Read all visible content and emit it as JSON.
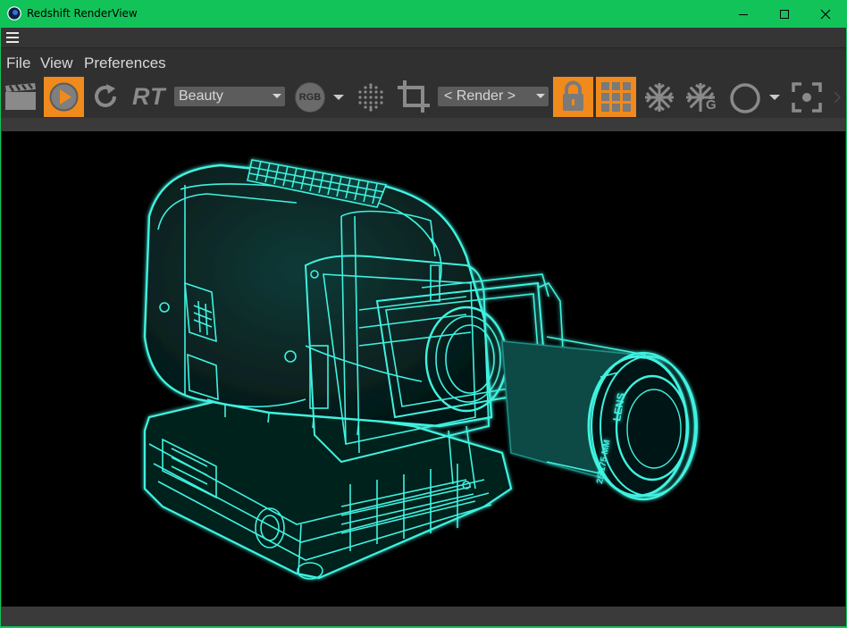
{
  "window": {
    "title": "Redshift RenderView",
    "controls": {
      "minimize": "—",
      "maximize": "☐",
      "close": "✕"
    },
    "frame_color": "#12c35a"
  },
  "menubar": {
    "items": [
      "File",
      "View",
      "Preferences"
    ]
  },
  "toolbar": {
    "rt_label": "RT",
    "aov_dropdown": "Beauty",
    "rgb_label": "RGB",
    "camera_dropdown": "< Render >",
    "accent_color": "#f08a1c",
    "icons": [
      "clapperboard-icon",
      "play-icon",
      "refresh-icon",
      "rt-icon",
      "rgb-icon",
      "dots-grid-icon",
      "crop-icon",
      "lock-icon",
      "grid-icon",
      "snowflake-icon",
      "snowflake-g-icon",
      "circle-icon",
      "focus-icon",
      "chevron-right-icon"
    ],
    "snowflake_g_label": "G"
  },
  "render": {
    "lens_text": [
      "LENS",
      "25/175 MM"
    ],
    "wire_color": "#3ff2e0"
  }
}
